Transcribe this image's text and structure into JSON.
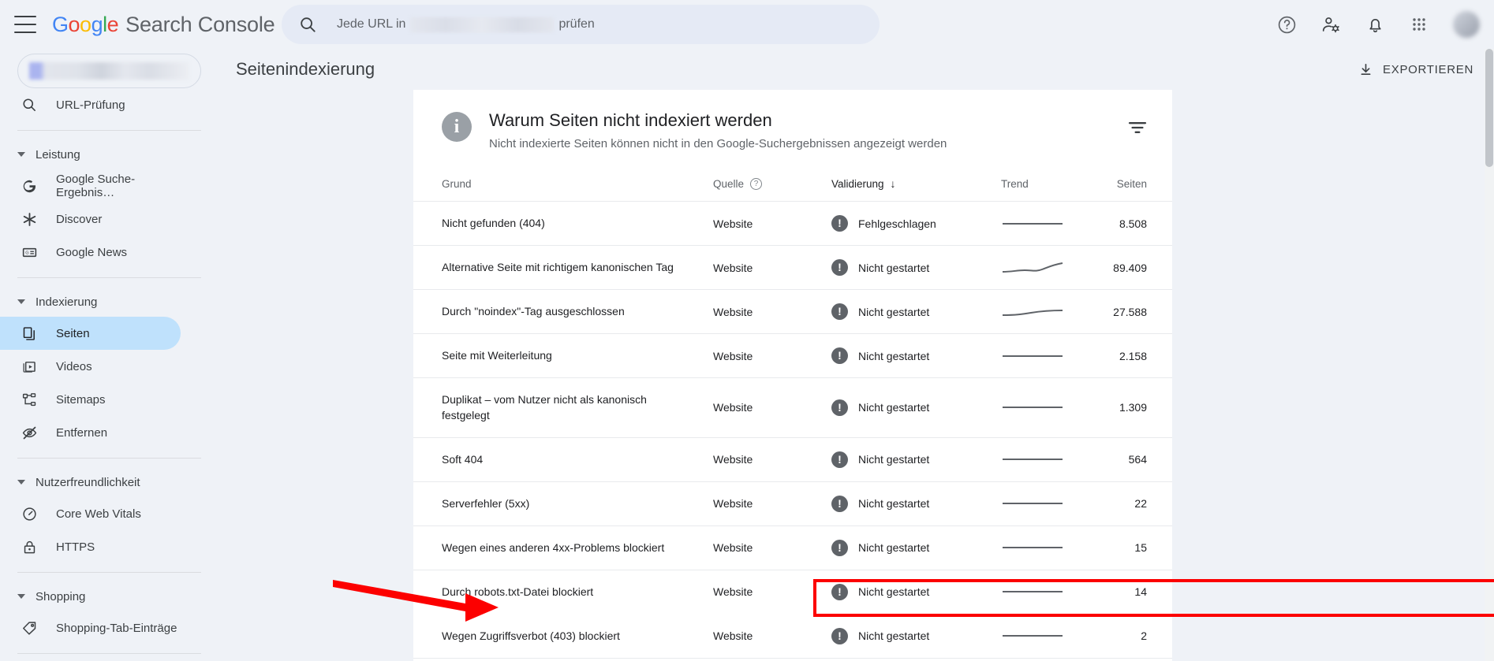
{
  "app": {
    "brand_google": "Google",
    "brand_word": "Search Console",
    "menu_icon": "hamburger-icon"
  },
  "search": {
    "prefix": "Jede URL in",
    "suffix": "prüfen",
    "icon": "search-icon"
  },
  "top_actions": [
    {
      "name": "help-icon",
      "label": "Hilfe"
    },
    {
      "name": "account-settings-icon",
      "label": "Einstellungen"
    },
    {
      "name": "notifications-bell-icon",
      "label": "Benachrichtigungen"
    },
    {
      "name": "apps-grid-icon",
      "label": "Google-Apps"
    }
  ],
  "sidebar": {
    "property_selector": "",
    "url_inspection": "URL-Prüfung",
    "groups": [
      {
        "label": "Leistung",
        "items": [
          {
            "label": "Google Suche-Ergebnis…",
            "icon": "google-g-icon",
            "active": false
          },
          {
            "label": "Discover",
            "icon": "discover-asterisk-icon",
            "active": false
          },
          {
            "label": "Google News",
            "icon": "google-news-icon",
            "active": false
          }
        ]
      },
      {
        "label": "Indexierung",
        "items": [
          {
            "label": "Seiten",
            "icon": "pages-icon",
            "active": true
          },
          {
            "label": "Videos",
            "icon": "videos-icon",
            "active": false
          },
          {
            "label": "Sitemaps",
            "icon": "sitemaps-icon",
            "active": false
          },
          {
            "label": "Entfernen",
            "icon": "eye-off-icon",
            "active": false
          }
        ]
      },
      {
        "label": "Nutzerfreundlichkeit",
        "items": [
          {
            "label": "Core Web Vitals",
            "icon": "speedometer-icon",
            "active": false
          },
          {
            "label": "HTTPS",
            "icon": "lock-icon",
            "active": false
          }
        ]
      },
      {
        "label": "Shopping",
        "items": [
          {
            "label": "Shopping-Tab-Einträge",
            "icon": "tag-icon",
            "active": false
          }
        ]
      }
    ]
  },
  "page": {
    "title": "Seitenindexierung",
    "export_label": "EXPORTIEREN",
    "export_icon": "download-icon"
  },
  "card": {
    "title": "Warum Seiten nicht indexiert werden",
    "subtitle": "Nicht indexierte Seiten können nicht in den Google-Suchergebnissen angezeigt werden",
    "info_icon": "info-icon",
    "filter_icon": "filter-funnel-icon",
    "columns": {
      "reason": "Grund",
      "source": "Quelle",
      "validation": "Validierung",
      "trend": "Trend",
      "pages": "Seiten"
    },
    "sort": {
      "column": "Validierung",
      "direction": "down",
      "glyph": "↓"
    },
    "rows": [
      {
        "reason": "Nicht gefunden (404)",
        "source": "Website",
        "validation": "Fehlgeschlagen",
        "pages": "8.508",
        "trend": "flat",
        "highlight": false
      },
      {
        "reason": "Alternative Seite mit richtigem kanonischen Tag",
        "source": "Website",
        "validation": "Nicht gestartet",
        "pages": "89.409",
        "trend": "rising",
        "highlight": false
      },
      {
        "reason": "Durch \"noindex\"-Tag ausgeschlossen",
        "source": "Website",
        "validation": "Nicht gestartet",
        "pages": "27.588",
        "trend": "slight-rise",
        "highlight": false
      },
      {
        "reason": "Seite mit Weiterleitung",
        "source": "Website",
        "validation": "Nicht gestartet",
        "pages": "2.158",
        "trend": "flat",
        "highlight": false
      },
      {
        "reason": "Duplikat – vom Nutzer nicht als kanonisch festgelegt",
        "source": "Website",
        "validation": "Nicht gestartet",
        "pages": "1.309",
        "trend": "flat",
        "highlight": false
      },
      {
        "reason": "Soft 404",
        "source": "Website",
        "validation": "Nicht gestartet",
        "pages": "564",
        "trend": "flat",
        "highlight": false
      },
      {
        "reason": "Serverfehler (5xx)",
        "source": "Website",
        "validation": "Nicht gestartet",
        "pages": "22",
        "trend": "flat",
        "highlight": false
      },
      {
        "reason": "Wegen eines anderen 4xx-Problems blockiert",
        "source": "Website",
        "validation": "Nicht gestartet",
        "pages": "15",
        "trend": "flat",
        "highlight": false
      },
      {
        "reason": "Durch robots.txt-Datei blockiert",
        "source": "Website",
        "validation": "Nicht gestartet",
        "pages": "14",
        "trend": "flat",
        "highlight": true
      },
      {
        "reason": "Wegen Zugriffsverbot (403) blockiert",
        "source": "Website",
        "validation": "Nicht gestartet",
        "pages": "2",
        "trend": "flat",
        "highlight": false
      }
    ]
  },
  "annotations": {
    "arrow_color": "#fc0000",
    "highlight_color": "#fc0000",
    "highlight_target": "Durch robots.txt-Datei blockiert"
  }
}
